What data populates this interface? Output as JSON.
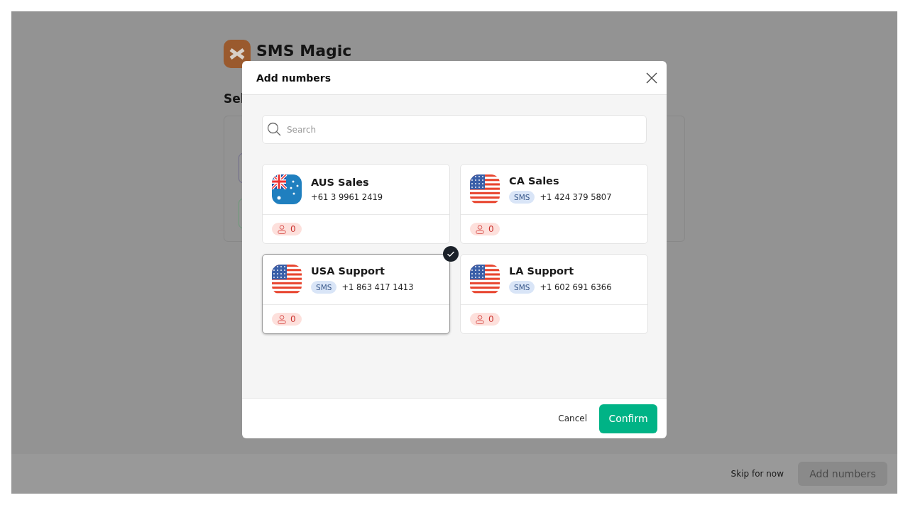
{
  "background": {
    "brand": "SMS Magic",
    "heading": "Sel",
    "skip_link": "Skip for now",
    "add_button": {
      "label": "Add numbers",
      "disabled": true
    }
  },
  "dialog": {
    "title": "Add numbers",
    "search": {
      "placeholder": "Search"
    },
    "numbers": [
      {
        "name": "AUS Sales",
        "kind": "au",
        "phone": "+61 3 9961 2419",
        "users": "0",
        "selected": false
      },
      {
        "name": "CA Sales",
        "kind": "us",
        "badge": "SMS",
        "phone": "+1 424 379 5807",
        "users": "0",
        "selected": false
      },
      {
        "name": "USA Support",
        "kind": "us",
        "badge": "SMS",
        "phone": "+1 863 417 1413",
        "users": "0",
        "selected": true
      },
      {
        "name": "LA Support",
        "kind": "us",
        "badge": "SMS",
        "phone": "+1 602 691 6366",
        "users": "0",
        "selected": false
      }
    ],
    "buttons": [
      {
        "label": "Cancel",
        "kind": "text"
      },
      {
        "label": "Confirm",
        "kind": "primary"
      }
    ]
  }
}
